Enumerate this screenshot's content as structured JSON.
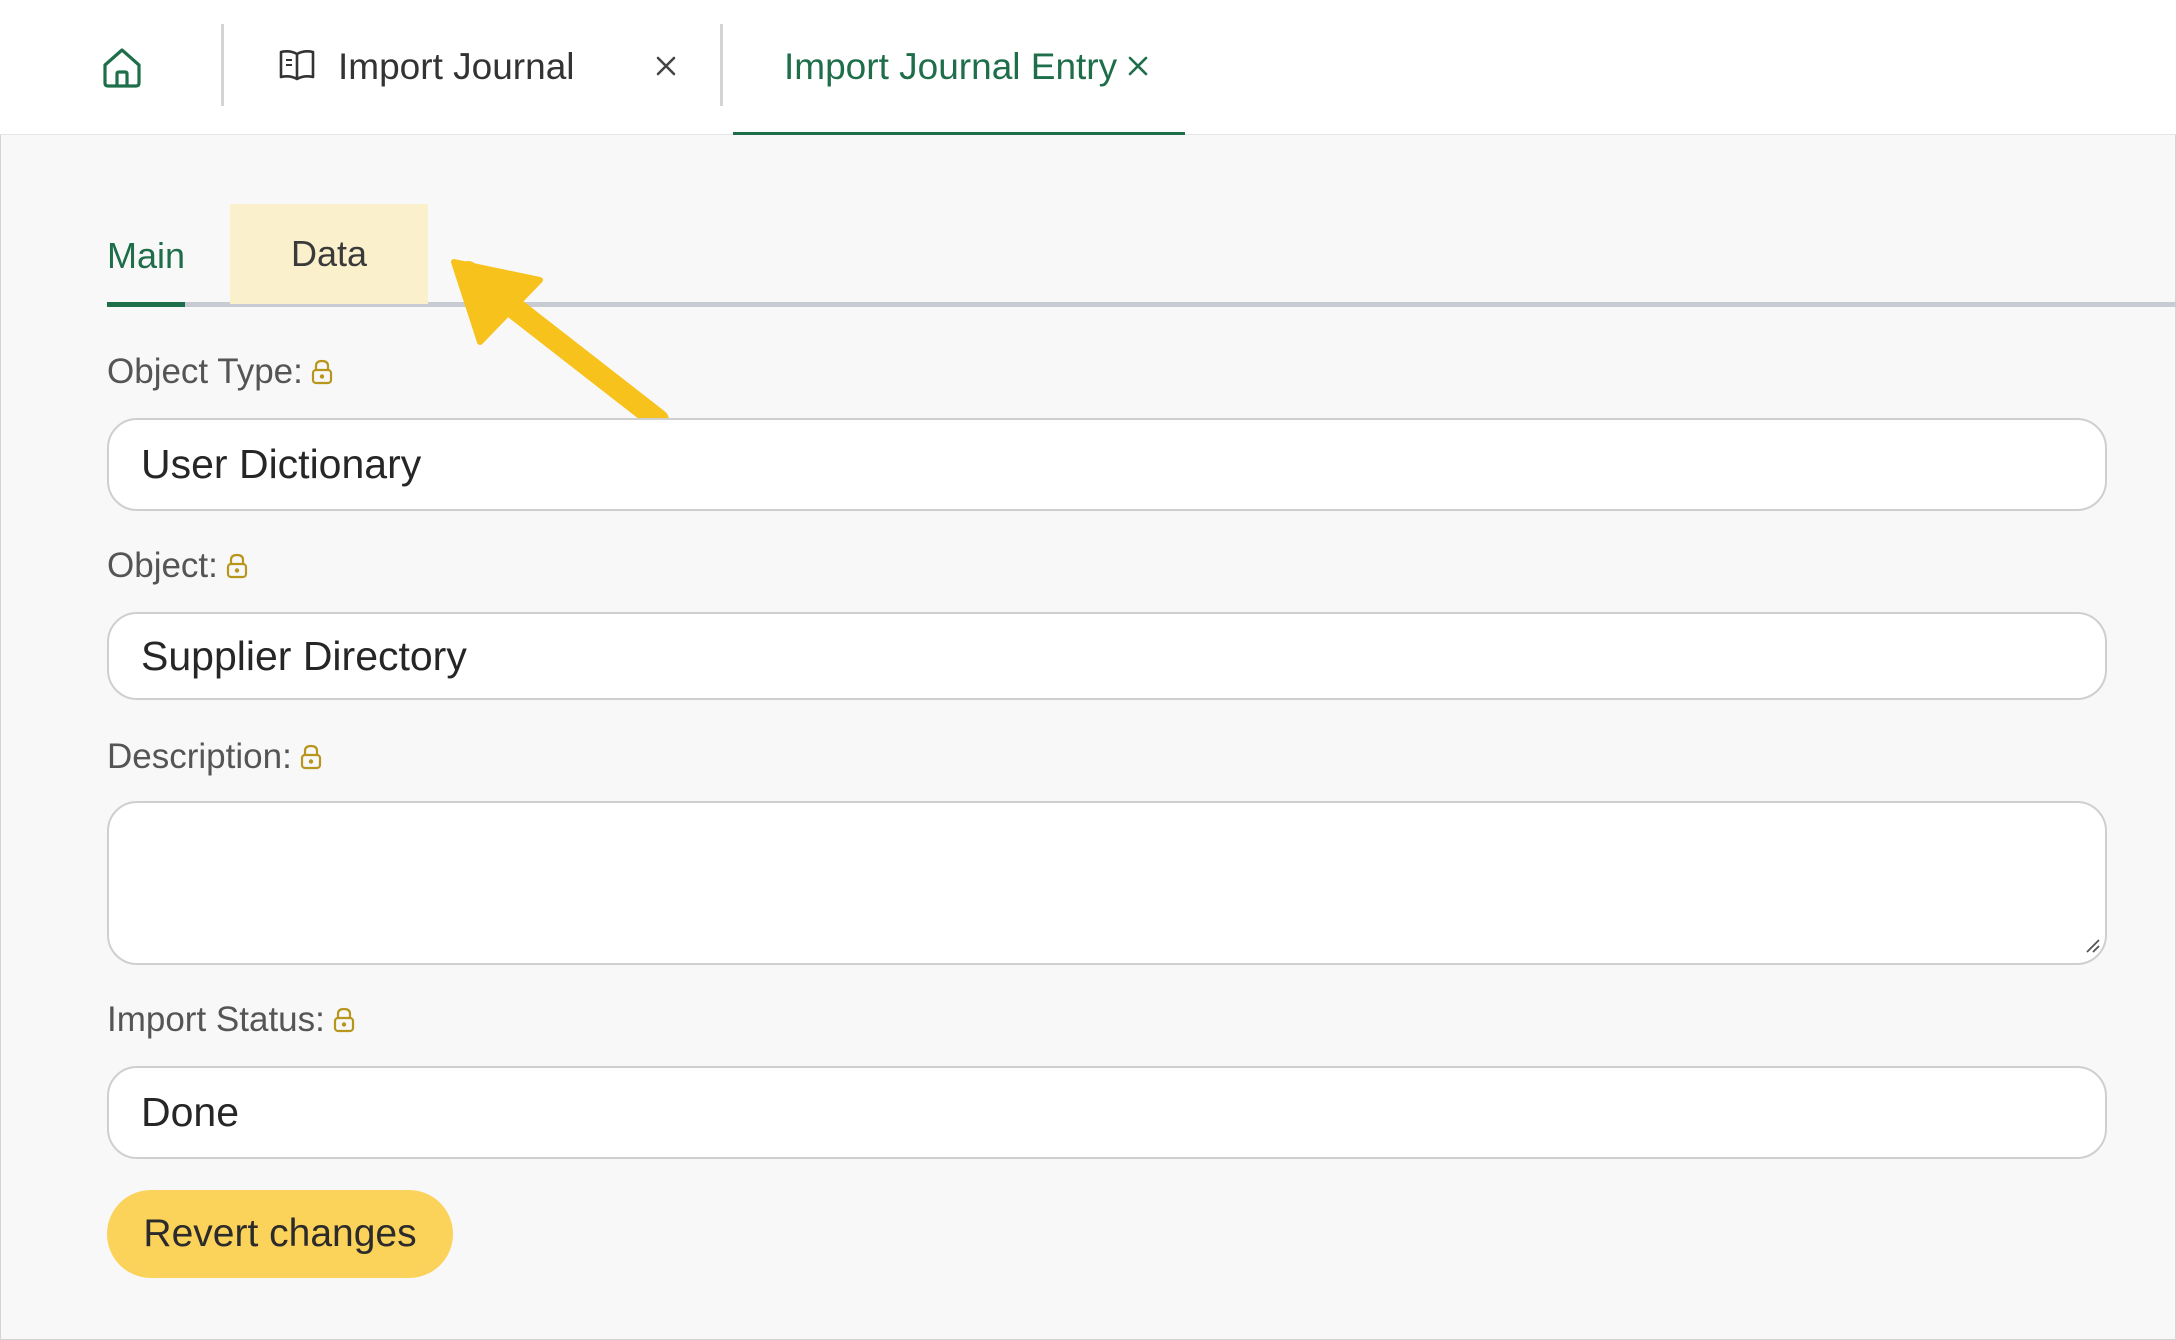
{
  "window_tabs": {
    "home_icon": "home-icon",
    "tabs": [
      {
        "label": "Import Journal",
        "icon": "book-icon",
        "active": false
      },
      {
        "label": "Import Journal Entry",
        "active": true
      }
    ],
    "close_icon": "close-icon"
  },
  "inner_tabs": [
    {
      "label": "Main",
      "active": true
    },
    {
      "label": "Data",
      "highlighted": true
    }
  ],
  "form": {
    "object_type": {
      "label": "Object Type:",
      "value": "User Dictionary",
      "locked": true
    },
    "object": {
      "label": "Object:",
      "value": "Supplier Directory",
      "locked": true
    },
    "description": {
      "label": "Description:",
      "value": "",
      "locked": true
    },
    "import_status": {
      "label": "Import Status:",
      "value": "Done",
      "locked": true
    }
  },
  "actions": {
    "revert_label": "Revert changes"
  },
  "colors": {
    "accent": "#1e6e4a",
    "highlight_tab": "#fbf0cc",
    "button": "#fbd25a",
    "arrow": "#f7c21c",
    "lock": "#b8961e"
  }
}
